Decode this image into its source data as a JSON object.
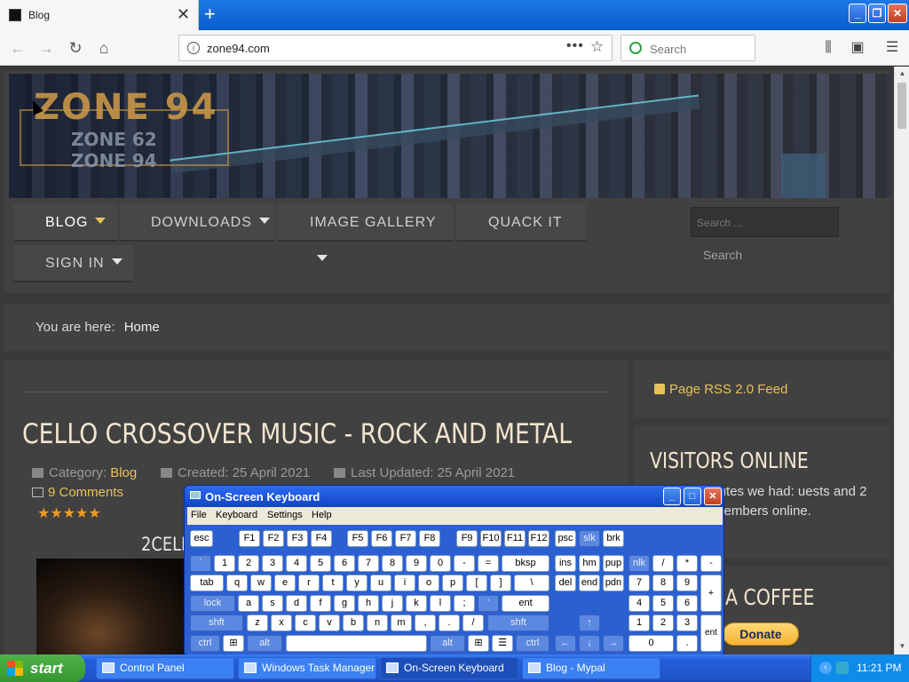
{
  "browser": {
    "tab_title": "Blog",
    "tab_close": "✕",
    "new_tab": "+",
    "url": "zone94.com",
    "search_placeholder": "Search",
    "window_buttons": {
      "minimize": "_",
      "maximize": "❐",
      "close": "✕"
    }
  },
  "site": {
    "logo_main": "ZONE 94",
    "logo_sub1": "ZONE 62",
    "logo_sub2": "ZONE 94",
    "menu": [
      {
        "label": "BLOG",
        "has_dropdown": true,
        "active": true
      },
      {
        "label": "DOWNLOADS",
        "has_dropdown": true
      },
      {
        "label": "IMAGE GALLERY",
        "has_dropdown": true
      },
      {
        "label": "QUACK IT",
        "has_dropdown": false
      },
      {
        "label": "SIGN IN",
        "has_dropdown": true
      }
    ],
    "search_placeholder": "Search ...",
    "search_button": "Search",
    "breadcrumb_prefix": "You are here:",
    "breadcrumb_current": "Home"
  },
  "article": {
    "title": "CELLO CROSSOVER MUSIC - ROCK AND METAL",
    "category_label": "Category:",
    "category": "Blog",
    "created": "Created: 25 April 2021",
    "updated": "Last Updated: 25 April 2021",
    "comments": "9 Comments",
    "stars": "★★★★★",
    "subheading": "2CELL"
  },
  "sidebar": {
    "rss": "Page RSS 2.0 Feed",
    "visitors_title": "VISITORS ONLINE",
    "visitors_text": "ast 15 minutes we had: uests and 2 members online.",
    "coffee_title": "A COFFEE",
    "donate": "Donate"
  },
  "osk": {
    "title": "On-Screen Keyboard",
    "menu": [
      "File",
      "Keyboard",
      "Settings",
      "Help"
    ],
    "titlebar_buttons": {
      "minimize": "_",
      "maximize": "□",
      "close": "✕"
    }
  },
  "taskbar": {
    "start": "start",
    "tasks": [
      "Control Panel",
      "Windows Task Manager",
      "On-Screen Keyboard",
      "Blog - Mypal"
    ],
    "clock": "11:21 PM"
  },
  "colors": {
    "accent": "#e8c15a",
    "page_bg": "#3a3a3a",
    "panel_bg": "#414141",
    "title_text": "#f2e5cf",
    "xp_blue": "#245edb",
    "xp_green": "#35962f"
  }
}
